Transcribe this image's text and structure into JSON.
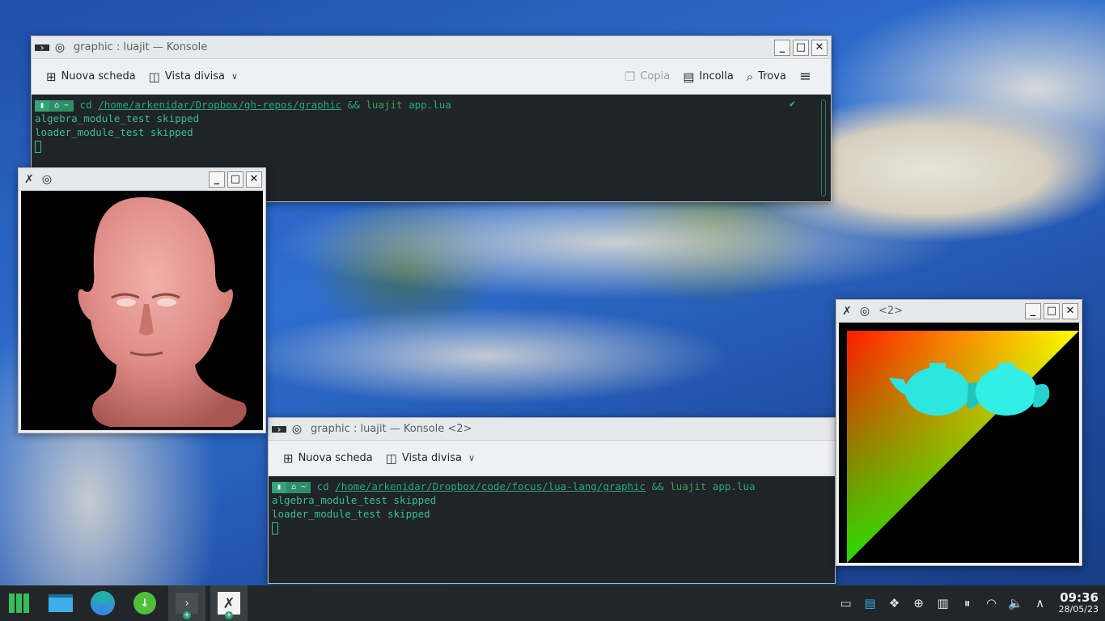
{
  "konsole1": {
    "title": "graphic : luajit — Konsole",
    "toolbar": {
      "new_tab": "Nuova scheda",
      "split_view": "Vista divisa",
      "copy": "Copia",
      "paste": "Incolla",
      "find": "Trova"
    },
    "prompt_dir": "~",
    "cmd": "cd",
    "path": "/home/arkenidar/Dropbox/gh-repos/graphic",
    "op": "&&",
    "exe": "luajit",
    "file": "app.lua",
    "out1": "algebra_module_test skipped",
    "out2": "loader_module_test skipped",
    "status": "✔"
  },
  "konsole2": {
    "title": "graphic : luajit — Konsole <2>",
    "toolbar": {
      "new_tab": "Nuova scheda",
      "split_view": "Vista divisa"
    },
    "prompt_dir": "~",
    "cmd": "cd",
    "path": "/home/arkenidar/Dropbox/code/focus/lua-lang/graphic",
    "op": "&&",
    "exe": "luajit",
    "file": "app.lua",
    "out1": "algebra_module_test skipped",
    "out2": "loader_module_test skipped"
  },
  "win_head": {
    "title": ""
  },
  "win_teapot": {
    "title": "<2>"
  },
  "clock": {
    "time": "09:36",
    "date": "28/05/23"
  },
  "colors": {
    "terminal_bg": "#1f2428",
    "terminal_fg": "#3bbf8f",
    "taskbar_bg": "#232629",
    "accent": "#2ca36c"
  }
}
